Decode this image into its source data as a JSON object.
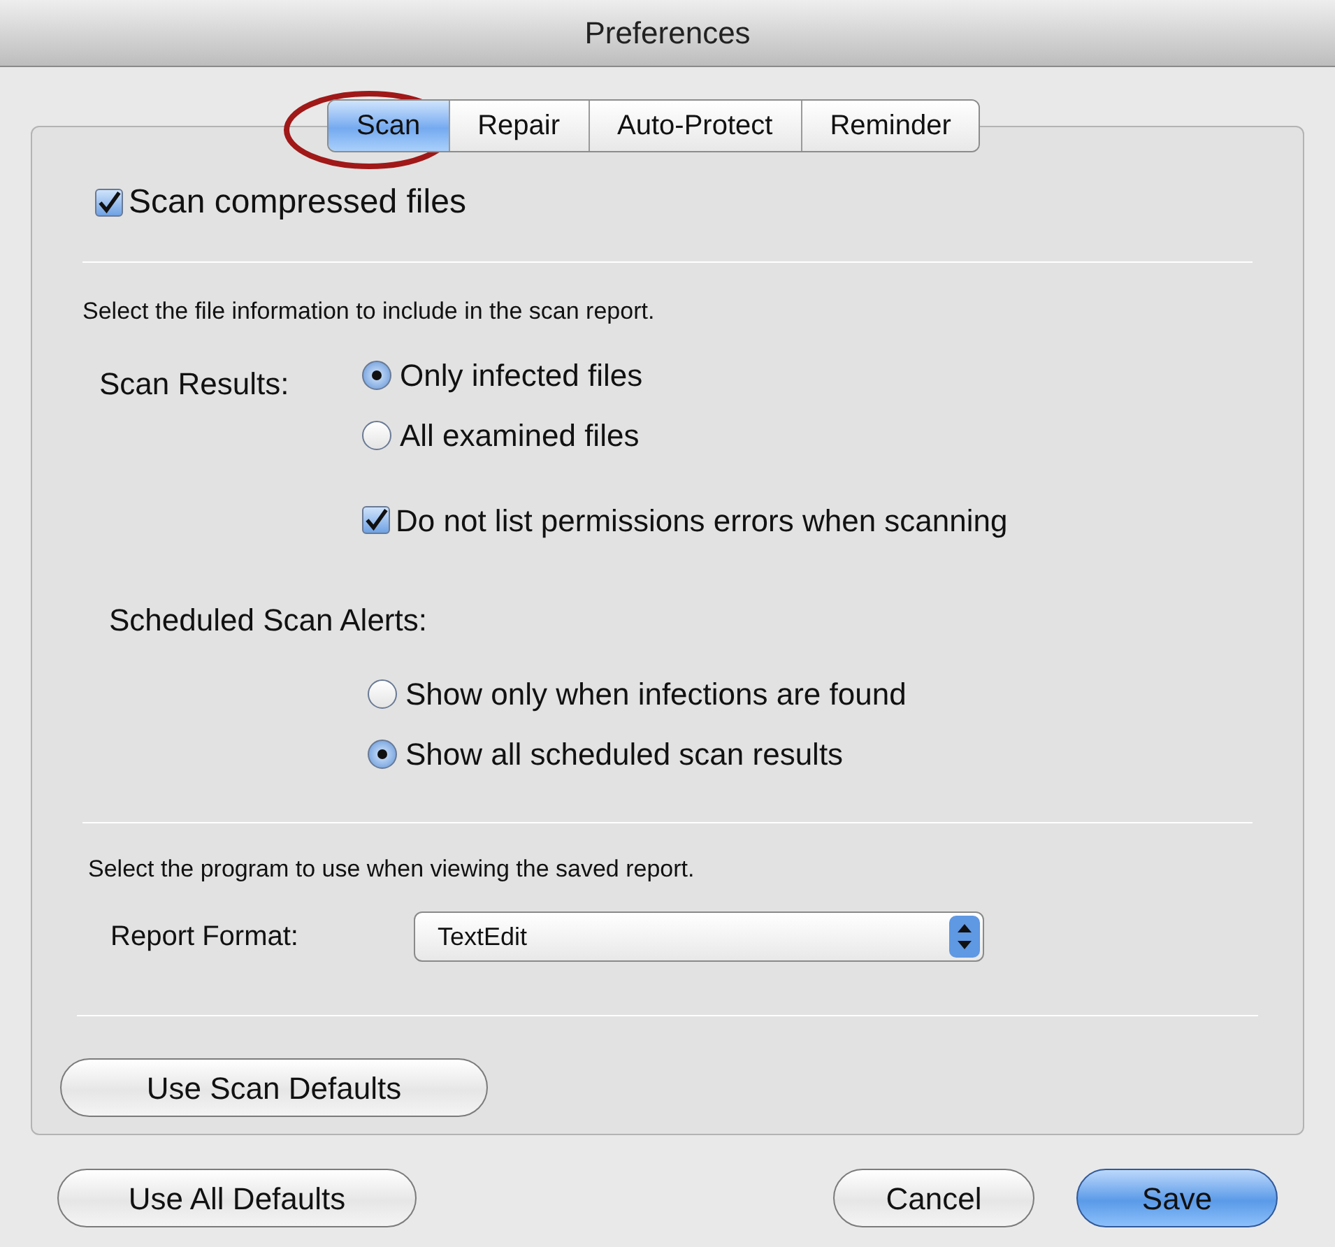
{
  "window": {
    "title": "Preferences"
  },
  "tabs": [
    {
      "label": "Scan",
      "selected": true
    },
    {
      "label": "Repair",
      "selected": false
    },
    {
      "label": "Auto-Protect",
      "selected": false
    },
    {
      "label": "Reminder",
      "selected": false
    }
  ],
  "scan_compressed": {
    "label": "Scan compressed files",
    "checked": true
  },
  "report_info": "Select the file information to include in the scan report.",
  "scan_results": {
    "label": "Scan Results:",
    "options": [
      {
        "label": "Only infected files",
        "selected": true
      },
      {
        "label": "All examined files",
        "selected": false
      }
    ]
  },
  "permissions": {
    "label": "Do not list permissions errors when scanning",
    "checked": true
  },
  "alerts": {
    "label": "Scheduled Scan Alerts:",
    "options": [
      {
        "label": "Show only when infections are found",
        "selected": false
      },
      {
        "label": "Show all scheduled scan results",
        "selected": true
      }
    ]
  },
  "program_info": "Select the program to use when viewing the saved report.",
  "report_format": {
    "label": "Report Format:",
    "value": "TextEdit"
  },
  "scan_defaults_button": "Use Scan Defaults",
  "buttons": [
    {
      "label": "Use All Defaults",
      "kind": "secondary"
    },
    {
      "label": "Cancel",
      "kind": "secondary"
    },
    {
      "label": "Save",
      "kind": "default"
    }
  ]
}
